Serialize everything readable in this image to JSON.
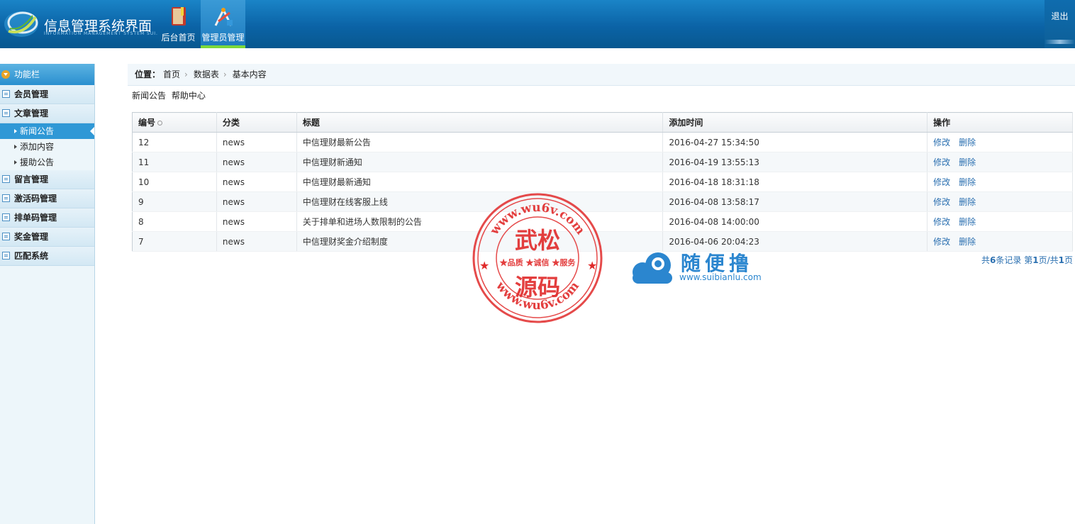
{
  "app": {
    "title": "信息管理系统界面",
    "subtitle": "INFORMATION MANAGEMENT SYSTEM SUI.",
    "logout": "退出"
  },
  "nav": [
    {
      "label": "后台首页",
      "icon": "book-icon",
      "active": false
    },
    {
      "label": "管理员管理",
      "icon": "tools-icon",
      "active": true
    }
  ],
  "sidebar": {
    "title": "功能栏",
    "groups": [
      {
        "label": "会员管理",
        "items": []
      },
      {
        "label": "文章管理",
        "items": [
          {
            "label": "新闻公告",
            "active": true
          },
          {
            "label": "添加内容",
            "active": false
          },
          {
            "label": "援助公告",
            "active": false
          }
        ]
      },
      {
        "label": "留言管理",
        "items": []
      },
      {
        "label": "激活码管理",
        "items": []
      },
      {
        "label": "排单码管理",
        "items": []
      },
      {
        "label": "奖金管理",
        "items": []
      },
      {
        "label": "匹配系统",
        "items": []
      }
    ]
  },
  "breadcrumb": {
    "label": "位置：",
    "items": [
      "首页",
      "数据表",
      "基本内容"
    ]
  },
  "tabs": [
    "新闻公告",
    "帮助中心"
  ],
  "table": {
    "columns": [
      "编号",
      "分类",
      "标题",
      "添加时间",
      "操作"
    ],
    "rows": [
      {
        "id": "12",
        "category": "news",
        "title": "中信理财最新公告",
        "time": "2016-04-27 15:34:50"
      },
      {
        "id": "11",
        "category": "news",
        "title": "中信理财新通知",
        "time": "2016-04-19 13:55:13"
      },
      {
        "id": "10",
        "category": "news",
        "title": "中信理财最新通知",
        "time": "2016-04-18 18:31:18"
      },
      {
        "id": "9",
        "category": "news",
        "title": "中信理财在线客服上线",
        "time": "2016-04-08 13:58:17"
      },
      {
        "id": "8",
        "category": "news",
        "title": "关于排单和进场人数限制的公告",
        "time": "2016-04-08 14:00:00"
      },
      {
        "id": "7",
        "category": "news",
        "title": "中信理财奖金介绍制度",
        "time": "2016-04-06 20:04:23"
      }
    ],
    "actions": {
      "edit": "修改",
      "delete": "删除"
    }
  },
  "pager": {
    "prefix": "共",
    "total": "6",
    "mid1": "条记录 第",
    "page": "1",
    "mid2": "页/共",
    "pages": "1",
    "suffix": "页"
  },
  "watermark": {
    "stamp_top": "www.wu6v.com",
    "stamp_big1": "武松",
    "stamp_mid": "★品质 ★诚信 ★服务",
    "stamp_big2": "源码",
    "stamp_bottom": "www.wu6v.com",
    "cloud_name": "随便撸",
    "cloud_url": "www.suibianlu.com"
  },
  "colors": {
    "header": "#0b63a6",
    "accent": "#2f98d6",
    "stamp": "#e02a2a",
    "link": "#2a6fb0"
  }
}
